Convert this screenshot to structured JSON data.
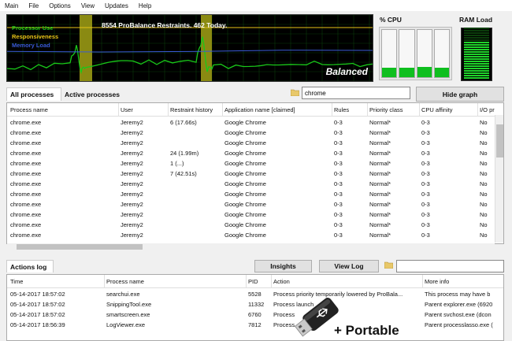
{
  "menu": [
    "Main",
    "File",
    "Options",
    "View",
    "Updates",
    "Help"
  ],
  "graph": {
    "legend": [
      {
        "label": "Processor Use",
        "color": "#19c819"
      },
      {
        "label": "Responsiveness",
        "color": "#e8c417"
      },
      {
        "label": "Memory Load",
        "color": "#3a5bd6"
      }
    ],
    "title": "8554 ProBalance Restraints. 462 Today.",
    "state": "Balanced"
  },
  "cpu": {
    "title": "% CPU",
    "cores": [
      0.2,
      0.2,
      0.22,
      0.2
    ]
  },
  "ram": {
    "title": "RAM Load",
    "level": 0.7
  },
  "tabs": {
    "all": "All processes",
    "active": "Active processes"
  },
  "filter_value": "chrome",
  "hide_graph_label": "Hide graph",
  "process_table": {
    "columns": [
      "Process name",
      "User",
      "Restraint history",
      "Application name [claimed]",
      "Rules",
      "Priority class",
      "CPU affinity",
      "I/O pr"
    ],
    "rows": [
      [
        "chrome.exe",
        "Jeremy2",
        "6 (17.66s)",
        "Google Chrome",
        "0-3",
        "Normal*",
        "0-3",
        "No"
      ],
      [
        "chrome.exe",
        "Jeremy2",
        "",
        "Google Chrome",
        "0-3",
        "Normal*",
        "0-3",
        "No"
      ],
      [
        "chrome.exe",
        "Jeremy2",
        "",
        "Google Chrome",
        "0-3",
        "Normal*",
        "0-3",
        "No"
      ],
      [
        "chrome.exe",
        "Jeremy2",
        "24 (1.99m)",
        "Google Chrome",
        "0-3",
        "Normal*",
        "0-3",
        "No"
      ],
      [
        "chrome.exe",
        "Jeremy2",
        "1 (...)",
        "Google Chrome",
        "0-3",
        "Normal*",
        "0-3",
        "No"
      ],
      [
        "chrome.exe",
        "Jeremy2",
        "7 (42.51s)",
        "Google Chrome",
        "0-3",
        "Normal*",
        "0-3",
        "No"
      ],
      [
        "chrome.exe",
        "Jeremy2",
        "",
        "Google Chrome",
        "0-3",
        "Normal*",
        "0-3",
        "No"
      ],
      [
        "chrome.exe",
        "Jeremy2",
        "",
        "Google Chrome",
        "0-3",
        "Normal*",
        "0-3",
        "No"
      ],
      [
        "chrome.exe",
        "Jeremy2",
        "",
        "Google Chrome",
        "0-3",
        "Normal*",
        "0-3",
        "No"
      ],
      [
        "chrome.exe",
        "Jeremy2",
        "",
        "Google Chrome",
        "0-3",
        "Normal*",
        "0-3",
        "No"
      ],
      [
        "chrome.exe",
        "Jeremy2",
        "",
        "Google Chrome",
        "0-3",
        "Normal*",
        "0-3",
        "No"
      ],
      [
        "chrome.exe",
        "Jeremy2",
        "",
        "Google Chrome",
        "0-3",
        "Normal*",
        "0-3",
        "No"
      ]
    ]
  },
  "actions_log": {
    "tab": "Actions log",
    "insights_label": "Insights",
    "view_log_label": "View Log",
    "columns": [
      "Time",
      "Process name",
      "PID",
      "Action",
      "More info"
    ],
    "rows": [
      [
        "05-14-2017 18:57:02",
        "searchui.exe",
        "5528",
        "Process priority temporarily lowered by ProBala...",
        "This process may have b"
      ],
      [
        "05-14-2017 18:57:02",
        "SnippingTool.exe",
        "11332",
        "Process launch",
        "Parent explorer.exe (6920"
      ],
      [
        "05-14-2017 18:57:02",
        "smartscreen.exe",
        "6760",
        "Process",
        "Parent svchost.exe (dcon"
      ],
      [
        "05-14-2017 18:56:39",
        "LogViewer.exe",
        "7812",
        "Process",
        "Parent processlasso.exe ("
      ]
    ]
  },
  "portable_label": "+ Portable"
}
